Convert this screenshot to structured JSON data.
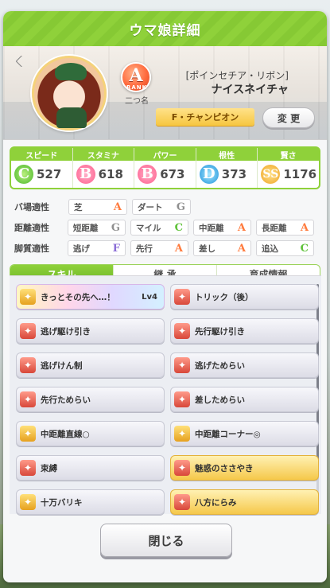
{
  "title": "ウマ娘詳細",
  "hero": {
    "rank_letter": "A",
    "rank_word": "RANK",
    "rank_sub": "二つ名",
    "epithet": "[ポインセチア・リボン]",
    "name": "ナイスネイチャ",
    "title_label": "F・チャンピオン",
    "change_button": "変 更"
  },
  "stats": [
    {
      "label": "スピード",
      "grade": "C",
      "grade_mark": "C+",
      "value": "527",
      "icon": "shoe-icon"
    },
    {
      "label": "スタミナ",
      "grade": "B",
      "value": "618",
      "icon": "heart-icon"
    },
    {
      "label": "パワー",
      "grade": "B",
      "value": "673",
      "icon": "muscle-icon"
    },
    {
      "label": "根性",
      "grade": "D",
      "grade_mark": "D+",
      "value": "373",
      "icon": "flame-icon"
    },
    {
      "label": "賢さ",
      "grade": "SS",
      "value": "1176",
      "icon": "graduation-cap-icon"
    }
  ],
  "aptitude": {
    "track": {
      "label": "バ場適性",
      "items": [
        {
          "name": "芝",
          "grade": "A"
        },
        {
          "name": "ダート",
          "grade": "G"
        }
      ]
    },
    "distance": {
      "label": "距離適性",
      "items": [
        {
          "name": "短距離",
          "grade": "G"
        },
        {
          "name": "マイル",
          "grade": "C"
        },
        {
          "name": "中距離",
          "grade": "A"
        },
        {
          "name": "長距離",
          "grade": "A"
        }
      ]
    },
    "style": {
      "label": "脚質適性",
      "items": [
        {
          "name": "逃げ",
          "grade": "F"
        },
        {
          "name": "先行",
          "grade": "A"
        },
        {
          "name": "差し",
          "grade": "A"
        },
        {
          "name": "追込",
          "grade": "C"
        }
      ]
    }
  },
  "tabs": [
    "スキル",
    "継 承",
    "育成情報"
  ],
  "skills": [
    {
      "name": "きっとその先へ…！",
      "lv": "Lv4",
      "style": "rainbow",
      "icon": "gold"
    },
    {
      "name": "トリック（後）",
      "style": "normal",
      "icon": "red"
    },
    {
      "name": "逃げ駆け引き",
      "style": "normal",
      "icon": "red"
    },
    {
      "name": "先行駆け引き",
      "style": "normal",
      "icon": "red"
    },
    {
      "name": "逃げけん制",
      "style": "normal",
      "icon": "red"
    },
    {
      "name": "逃げためらい",
      "style": "normal",
      "icon": "red"
    },
    {
      "name": "先行ためらい",
      "style": "normal",
      "icon": "red"
    },
    {
      "name": "差しためらい",
      "style": "normal",
      "icon": "red"
    },
    {
      "name": "中距離直線○",
      "style": "normal",
      "icon": "gold"
    },
    {
      "name": "中距離コーナー◎",
      "style": "normal",
      "icon": "gold"
    },
    {
      "name": "束縛",
      "style": "normal",
      "icon": "red"
    },
    {
      "name": "魅惑のささやき",
      "style": "gold",
      "icon": "red"
    },
    {
      "name": "十万バリキ",
      "style": "normal",
      "icon": "gold"
    },
    {
      "name": "八方にらみ",
      "style": "gold",
      "icon": "red"
    }
  ],
  "close_button": "閉じる",
  "colors": {
    "accent": "#8fd13a",
    "rank": "#ff6a3d",
    "gold": "#f5c84a"
  }
}
